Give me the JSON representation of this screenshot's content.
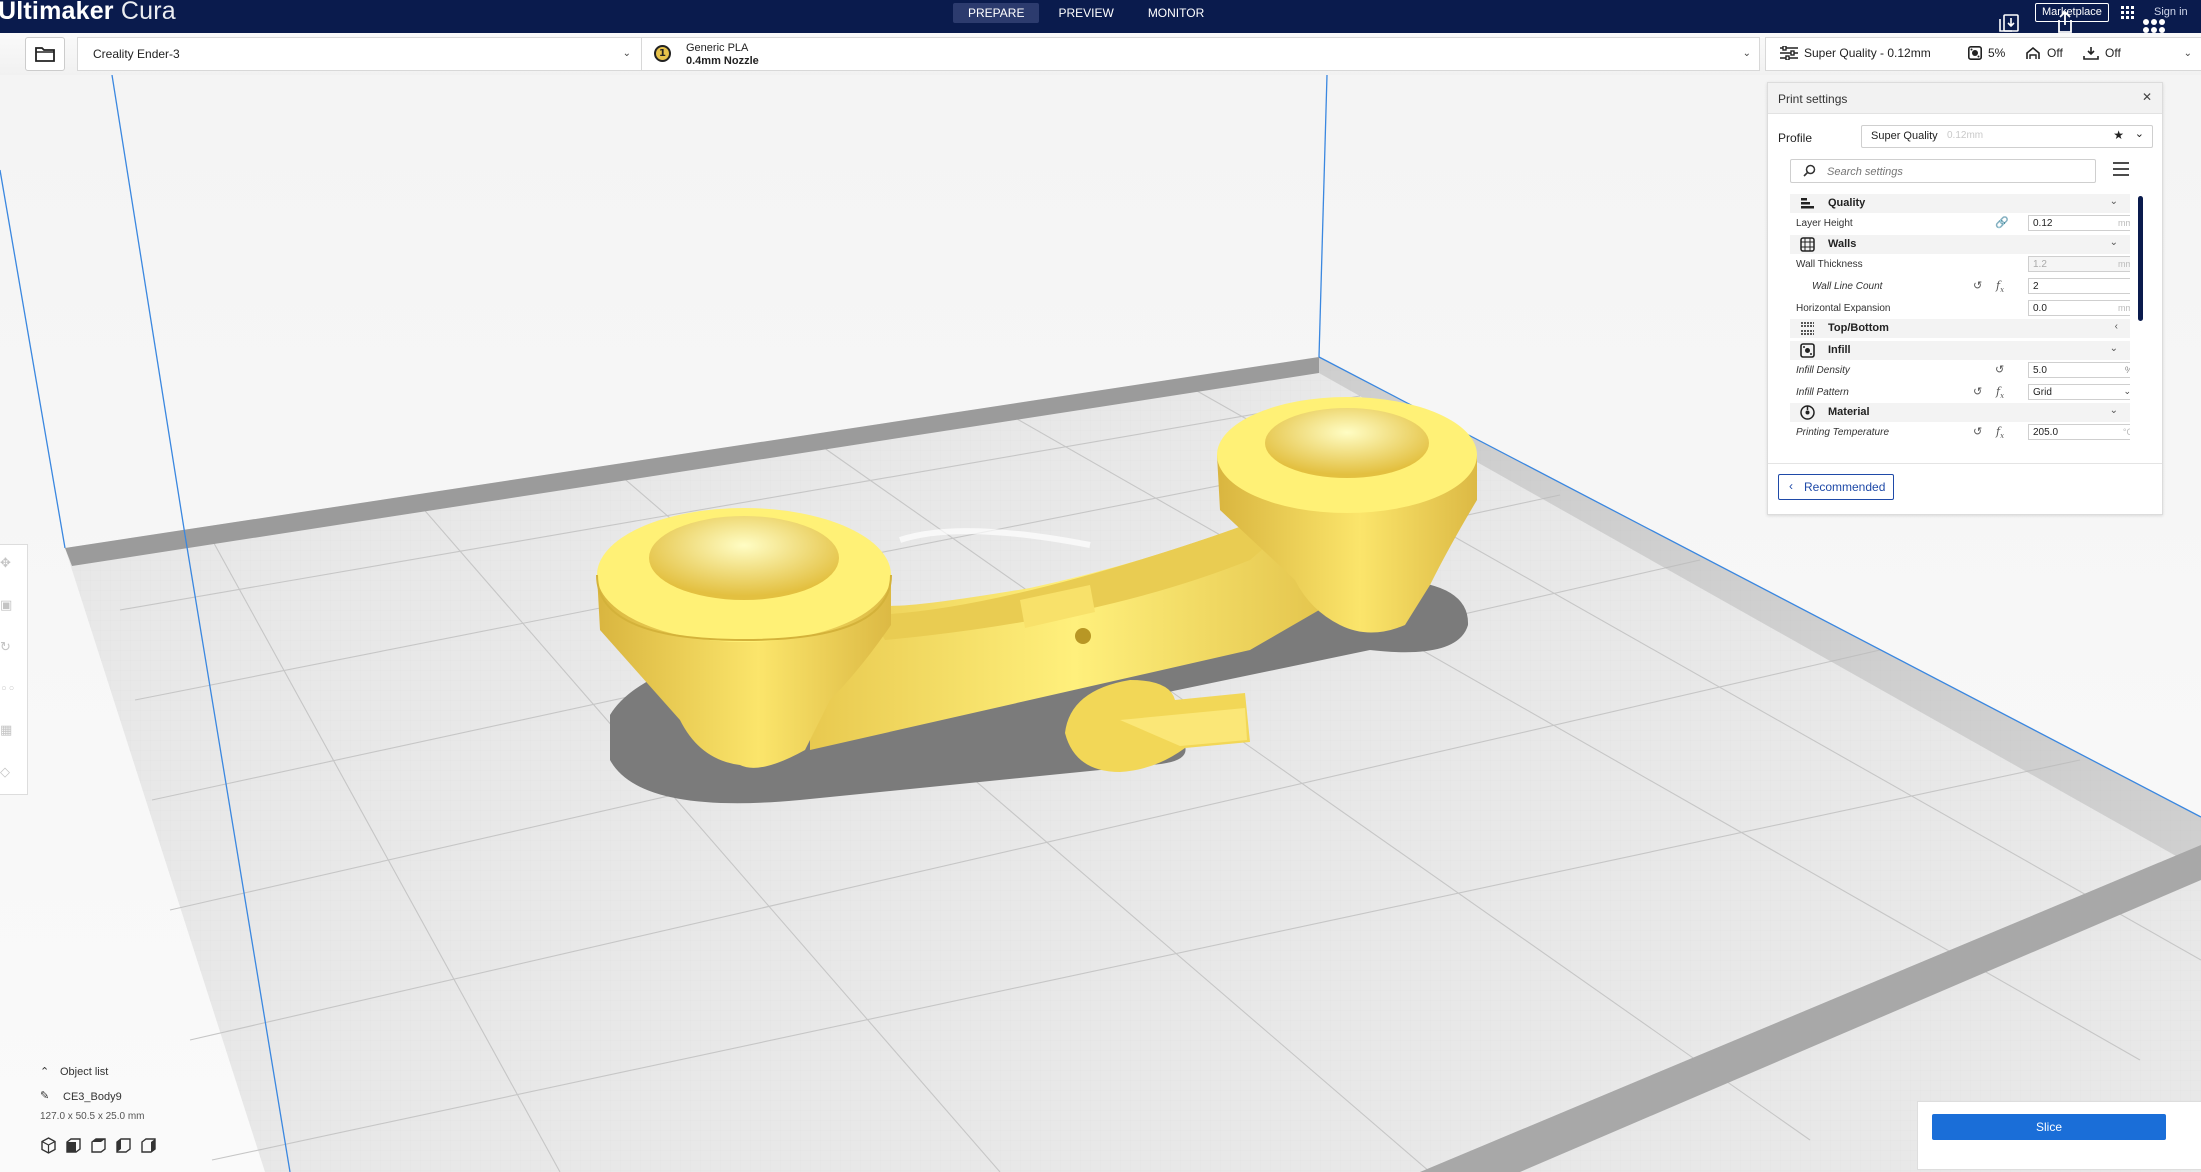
{
  "app": {
    "logo_bold": "Ultimaker",
    "logo_light": " Cura"
  },
  "stages": [
    {
      "label": "PREPARE",
      "active": true
    },
    {
      "label": "PREVIEW",
      "active": false
    },
    {
      "label": "MONITOR",
      "active": false
    }
  ],
  "header": {
    "marketplace_label": "Marketplace",
    "signin_label": "Sign in"
  },
  "printer": {
    "name": "Creality Ender-3"
  },
  "material": {
    "extruder_number": "1",
    "name": "Generic PLA",
    "nozzle": "0.4mm Nozzle",
    "badge_color": "#e7c24b"
  },
  "print_summary": {
    "profile": "Super Quality - 0.12mm",
    "infill": "5%",
    "support": "Off",
    "adhesion": "Off"
  },
  "print_settings": {
    "title": "Print settings",
    "profile_label": "Profile",
    "profile_name": "Super Quality",
    "profile_sub": "0.12mm",
    "search_placeholder": "Search settings",
    "categories": {
      "quality": "Quality",
      "walls": "Walls",
      "topbottom": "Top/Bottom",
      "infill": "Infill",
      "material": "Material"
    },
    "settings": {
      "layer_height": {
        "label": "Layer Height",
        "value": "0.12",
        "unit": "mm"
      },
      "wall_thickness": {
        "label": "Wall Thickness",
        "value": "1.2",
        "unit": "mm"
      },
      "wall_line_count": {
        "label": "Wall Line Count",
        "value": "2"
      },
      "horizontal_expansion": {
        "label": "Horizontal Expansion",
        "value": "0.0",
        "unit": "mm"
      },
      "infill_density": {
        "label": "Infill Density",
        "value": "5.0",
        "unit": "%"
      },
      "infill_pattern": {
        "label": "Infill Pattern",
        "value": "Grid"
      },
      "printing_temperature": {
        "label": "Printing Temperature",
        "value": "205.0",
        "unit": "°C"
      }
    },
    "recommended_label": "Recommended"
  },
  "object_list": {
    "title": "Object list",
    "object_name": "CE3_Body9",
    "dimensions": "127.0 x 50.5 x 25.0 mm"
  },
  "slice": {
    "button_label": "Slice",
    "accent": "#1a6ed8"
  },
  "colors": {
    "header_bg": "#0a1b4d",
    "model": "#f4dc5f",
    "build_plate": "#e6e6e6"
  }
}
